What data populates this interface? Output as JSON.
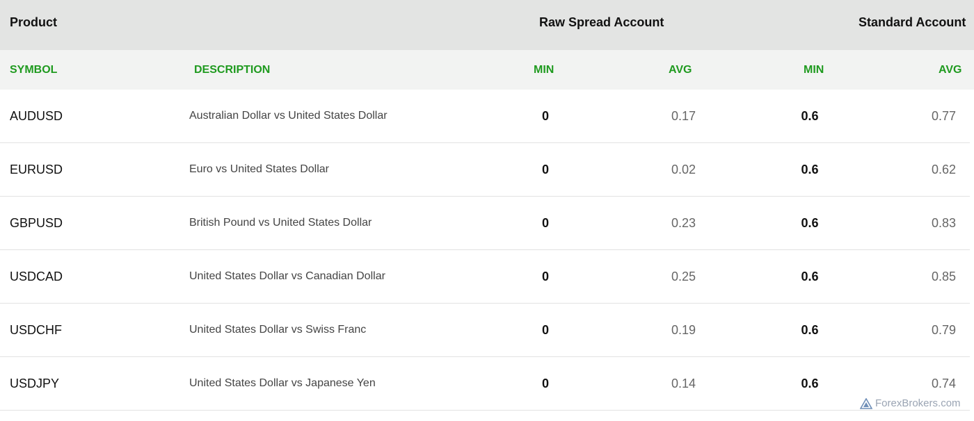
{
  "header": {
    "product": "Product",
    "raw_spread": "Raw Spread Account",
    "standard": "Standard Account"
  },
  "columns": {
    "symbol": "SYMBOL",
    "description": "DESCRIPTION",
    "raw_min": "MIN",
    "raw_avg": "AVG",
    "std_min": "MIN",
    "std_avg": "AVG"
  },
  "rows": [
    {
      "symbol": "AUDUSD",
      "description": "Australian Dollar vs United States Dollar",
      "raw_min": "0",
      "raw_avg": "0.17",
      "std_min": "0.6",
      "std_avg": "0.77"
    },
    {
      "symbol": "EURUSD",
      "description": "Euro vs United States Dollar",
      "raw_min": "0",
      "raw_avg": "0.02",
      "std_min": "0.6",
      "std_avg": "0.62"
    },
    {
      "symbol": "GBPUSD",
      "description": "British Pound vs United States Dollar",
      "raw_min": "0",
      "raw_avg": "0.23",
      "std_min": "0.6",
      "std_avg": "0.83"
    },
    {
      "symbol": "USDCAD",
      "description": "United States Dollar vs Canadian Dollar",
      "raw_min": "0",
      "raw_avg": "0.25",
      "std_min": "0.6",
      "std_avg": "0.85"
    },
    {
      "symbol": "USDCHF",
      "description": "United States Dollar vs Swiss Franc",
      "raw_min": "0",
      "raw_avg": "0.19",
      "std_min": "0.6",
      "std_avg": "0.79"
    },
    {
      "symbol": "USDJPY",
      "description": "United States Dollar vs Japanese Yen",
      "raw_min": "0",
      "raw_avg": "0.14",
      "std_min": "0.6",
      "std_avg": "0.74"
    }
  ],
  "watermark": {
    "text": "ForexBrokers.com",
    "icon": "forexbrokers-logo-icon"
  },
  "colors": {
    "accent_green": "#1f9a1f",
    "header_bg": "#e3e4e3",
    "subheader_bg": "#f2f3f2"
  }
}
